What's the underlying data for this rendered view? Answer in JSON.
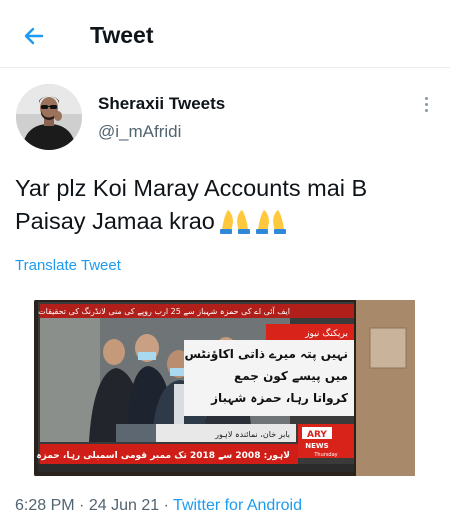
{
  "header": {
    "title": "Tweet",
    "back_icon": "arrow-left-icon"
  },
  "author": {
    "name": "Sheraxii Tweets",
    "handle": "@i_mAfridi"
  },
  "tweet": {
    "text": "Yar plz Koi Maray Accounts mai B Paisay Jamaa krao",
    "emoji": "folded-hands-emoji",
    "translate_label": "Translate Tweet"
  },
  "media": {
    "top_strip": "ایف آئی اے کی حمزہ شہباز سے 25 ارب روپے کی منی لانڈرنگ کی تحقیقات",
    "breaking_badge": "بریکنگ نیوز",
    "headline_1": "نہیں پتہ میرے ذاتی اکاؤنٹس",
    "headline_2": "میں پیسے کون جمع",
    "headline_3": "کرواتا رہا، حمزہ شہباز",
    "reporter": "بابر خان، نمائندہ لاہور",
    "channel_logo": "ARY",
    "channel_sub": "NEWS",
    "day": "Thursday",
    "ticker": "لاہور: 2008 سے 2018 تک ممبر قومی اسمبلی رہا، حمزہ شہباز"
  },
  "meta": {
    "time": "6:28 PM",
    "date": "24 Jun 21",
    "separator": "·",
    "source": "Twitter for Android"
  },
  "colors": {
    "link": "#1d9bf0",
    "secondary_text": "#536471",
    "ary_red": "#d8231b"
  }
}
